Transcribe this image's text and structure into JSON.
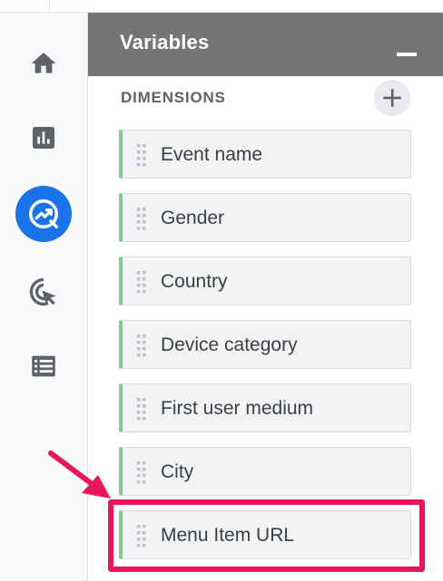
{
  "panel": {
    "title": "Variables",
    "section_label": "DIMENSIONS"
  },
  "nav": {
    "items": [
      {
        "icon": "home-icon"
      },
      {
        "icon": "reports-icon"
      },
      {
        "icon": "explore-icon",
        "active": true
      },
      {
        "icon": "advertising-icon"
      },
      {
        "icon": "list-icon"
      }
    ]
  },
  "dimensions": [
    {
      "label": "Event name"
    },
    {
      "label": "Gender"
    },
    {
      "label": "Country"
    },
    {
      "label": "Device category"
    },
    {
      "label": "First user medium"
    },
    {
      "label": "City"
    },
    {
      "label": "Menu Item URL"
    }
  ],
  "colors": {
    "header_bg": "#757575",
    "accent_blue": "#1a73e8",
    "chip_border_green": "#81c995",
    "highlight_pink": "#e8175d"
  }
}
